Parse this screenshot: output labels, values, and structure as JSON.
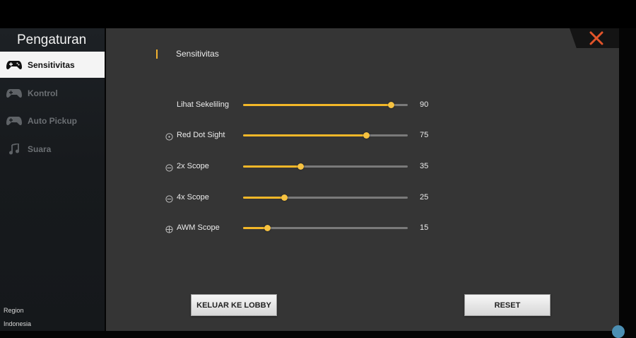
{
  "sidebar": {
    "title": "Pengaturan",
    "items": [
      {
        "label": "Sensitivitas",
        "icon": "gamepad-icon",
        "active": true
      },
      {
        "label": "Kontrol",
        "icon": "gamepad-icon",
        "active": false
      },
      {
        "label": "Auto Pickup",
        "icon": "gamepad-icon",
        "active": false
      },
      {
        "label": "Suara",
        "icon": "music-note-icon",
        "active": false
      }
    ],
    "region_label": "Region",
    "region_value": "Indonesia"
  },
  "section": {
    "title": "Sensitivitas"
  },
  "sliders": [
    {
      "label": "Lihat Sekeliling",
      "value": 90,
      "icon": null
    },
    {
      "label": "Red Dot Sight",
      "value": 75,
      "icon": "red-dot-scope-icon"
    },
    {
      "label": "2x Scope",
      "value": 35,
      "icon": "scope-icon"
    },
    {
      "label": "4x Scope",
      "value": 25,
      "icon": "scope-icon"
    },
    {
      "label": "AWM Scope",
      "value": 15,
      "icon": "crosshair-icon"
    }
  ],
  "buttons": {
    "lobby": "KELUAR KE LOBBY",
    "reset": "RESET"
  },
  "colors": {
    "accent": "#f3b728",
    "close": "#e2542a",
    "panel": "#353535",
    "sidebar": "#1b1f22"
  }
}
